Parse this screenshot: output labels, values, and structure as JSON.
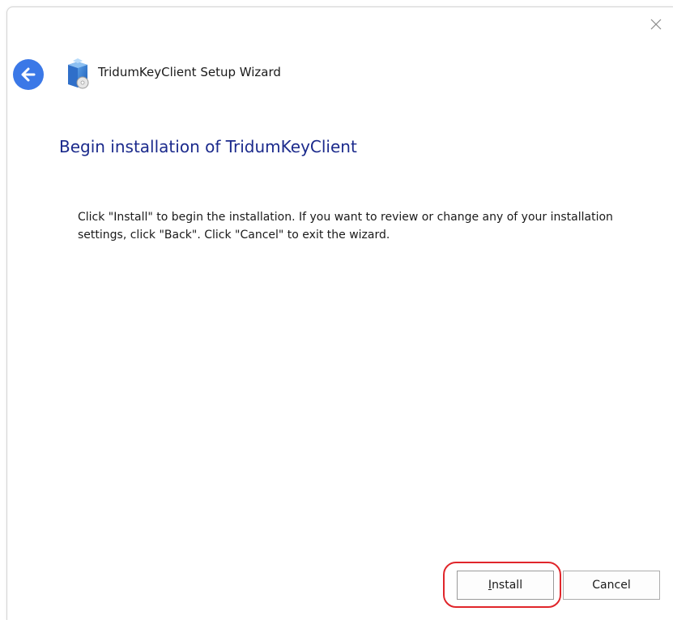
{
  "window": {
    "title": "TridumKeyClient Setup Wizard"
  },
  "page": {
    "heading": "Begin installation of TridumKeyClient",
    "instructions": "Click \"Install\" to begin the installation.  If you want to review or change any of your installation settings, click \"Back\".  Click \"Cancel\" to exit the wizard."
  },
  "buttons": {
    "install_mnemonic": "I",
    "install_rest": "nstall",
    "cancel": "Cancel"
  },
  "icons": {
    "close": "close-icon",
    "back": "back-arrow-icon",
    "app": "installer-app-icon"
  },
  "colors": {
    "accent": "#3b78e7",
    "heading": "#1b2a8c",
    "highlight": "#e0262b"
  }
}
